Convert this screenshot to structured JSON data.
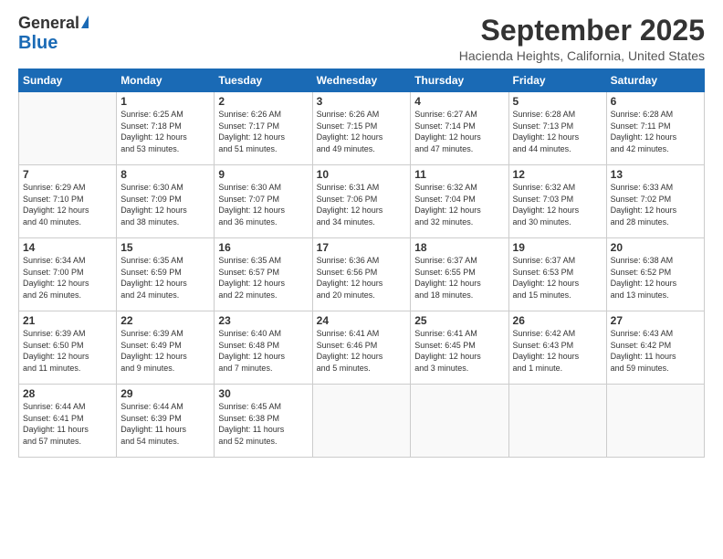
{
  "header": {
    "logo_line1": "General",
    "logo_line2": "Blue",
    "month": "September 2025",
    "location": "Hacienda Heights, California, United States"
  },
  "weekdays": [
    "Sunday",
    "Monday",
    "Tuesday",
    "Wednesday",
    "Thursday",
    "Friday",
    "Saturday"
  ],
  "weeks": [
    [
      {
        "day": "",
        "info": ""
      },
      {
        "day": "1",
        "info": "Sunrise: 6:25 AM\nSunset: 7:18 PM\nDaylight: 12 hours\nand 53 minutes."
      },
      {
        "day": "2",
        "info": "Sunrise: 6:26 AM\nSunset: 7:17 PM\nDaylight: 12 hours\nand 51 minutes."
      },
      {
        "day": "3",
        "info": "Sunrise: 6:26 AM\nSunset: 7:15 PM\nDaylight: 12 hours\nand 49 minutes."
      },
      {
        "day": "4",
        "info": "Sunrise: 6:27 AM\nSunset: 7:14 PM\nDaylight: 12 hours\nand 47 minutes."
      },
      {
        "day": "5",
        "info": "Sunrise: 6:28 AM\nSunset: 7:13 PM\nDaylight: 12 hours\nand 44 minutes."
      },
      {
        "day": "6",
        "info": "Sunrise: 6:28 AM\nSunset: 7:11 PM\nDaylight: 12 hours\nand 42 minutes."
      }
    ],
    [
      {
        "day": "7",
        "info": "Sunrise: 6:29 AM\nSunset: 7:10 PM\nDaylight: 12 hours\nand 40 minutes."
      },
      {
        "day": "8",
        "info": "Sunrise: 6:30 AM\nSunset: 7:09 PM\nDaylight: 12 hours\nand 38 minutes."
      },
      {
        "day": "9",
        "info": "Sunrise: 6:30 AM\nSunset: 7:07 PM\nDaylight: 12 hours\nand 36 minutes."
      },
      {
        "day": "10",
        "info": "Sunrise: 6:31 AM\nSunset: 7:06 PM\nDaylight: 12 hours\nand 34 minutes."
      },
      {
        "day": "11",
        "info": "Sunrise: 6:32 AM\nSunset: 7:04 PM\nDaylight: 12 hours\nand 32 minutes."
      },
      {
        "day": "12",
        "info": "Sunrise: 6:32 AM\nSunset: 7:03 PM\nDaylight: 12 hours\nand 30 minutes."
      },
      {
        "day": "13",
        "info": "Sunrise: 6:33 AM\nSunset: 7:02 PM\nDaylight: 12 hours\nand 28 minutes."
      }
    ],
    [
      {
        "day": "14",
        "info": "Sunrise: 6:34 AM\nSunset: 7:00 PM\nDaylight: 12 hours\nand 26 minutes."
      },
      {
        "day": "15",
        "info": "Sunrise: 6:35 AM\nSunset: 6:59 PM\nDaylight: 12 hours\nand 24 minutes."
      },
      {
        "day": "16",
        "info": "Sunrise: 6:35 AM\nSunset: 6:57 PM\nDaylight: 12 hours\nand 22 minutes."
      },
      {
        "day": "17",
        "info": "Sunrise: 6:36 AM\nSunset: 6:56 PM\nDaylight: 12 hours\nand 20 minutes."
      },
      {
        "day": "18",
        "info": "Sunrise: 6:37 AM\nSunset: 6:55 PM\nDaylight: 12 hours\nand 18 minutes."
      },
      {
        "day": "19",
        "info": "Sunrise: 6:37 AM\nSunset: 6:53 PM\nDaylight: 12 hours\nand 15 minutes."
      },
      {
        "day": "20",
        "info": "Sunrise: 6:38 AM\nSunset: 6:52 PM\nDaylight: 12 hours\nand 13 minutes."
      }
    ],
    [
      {
        "day": "21",
        "info": "Sunrise: 6:39 AM\nSunset: 6:50 PM\nDaylight: 12 hours\nand 11 minutes."
      },
      {
        "day": "22",
        "info": "Sunrise: 6:39 AM\nSunset: 6:49 PM\nDaylight: 12 hours\nand 9 minutes."
      },
      {
        "day": "23",
        "info": "Sunrise: 6:40 AM\nSunset: 6:48 PM\nDaylight: 12 hours\nand 7 minutes."
      },
      {
        "day": "24",
        "info": "Sunrise: 6:41 AM\nSunset: 6:46 PM\nDaylight: 12 hours\nand 5 minutes."
      },
      {
        "day": "25",
        "info": "Sunrise: 6:41 AM\nSunset: 6:45 PM\nDaylight: 12 hours\nand 3 minutes."
      },
      {
        "day": "26",
        "info": "Sunrise: 6:42 AM\nSunset: 6:43 PM\nDaylight: 12 hours\nand 1 minute."
      },
      {
        "day": "27",
        "info": "Sunrise: 6:43 AM\nSunset: 6:42 PM\nDaylight: 11 hours\nand 59 minutes."
      }
    ],
    [
      {
        "day": "28",
        "info": "Sunrise: 6:44 AM\nSunset: 6:41 PM\nDaylight: 11 hours\nand 57 minutes."
      },
      {
        "day": "29",
        "info": "Sunrise: 6:44 AM\nSunset: 6:39 PM\nDaylight: 11 hours\nand 54 minutes."
      },
      {
        "day": "30",
        "info": "Sunrise: 6:45 AM\nSunset: 6:38 PM\nDaylight: 11 hours\nand 52 minutes."
      },
      {
        "day": "",
        "info": ""
      },
      {
        "day": "",
        "info": ""
      },
      {
        "day": "",
        "info": ""
      },
      {
        "day": "",
        "info": ""
      }
    ]
  ]
}
